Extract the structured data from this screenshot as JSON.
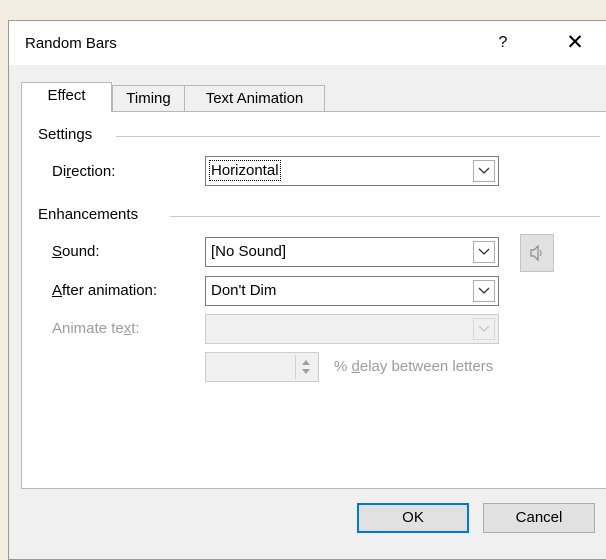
{
  "dialog": {
    "title": "Random Bars",
    "help_glyph": "?",
    "close_glyph": "✕"
  },
  "tabs": [
    {
      "label": "Effect",
      "active": true
    },
    {
      "label": "Timing",
      "active": false
    },
    {
      "label": "Text Animation",
      "active": false
    }
  ],
  "settings": {
    "group_label": "Settings",
    "direction": {
      "label_pre": "Di",
      "label_ul": "r",
      "label_post": "ection:",
      "value": "Horizontal"
    }
  },
  "enhancements": {
    "group_label": "Enhancements",
    "sound": {
      "label_ul": "S",
      "label_post": "ound:",
      "value": "[No Sound]",
      "speaker_icon": "speaker-icon"
    },
    "after_animation": {
      "label_ul": "A",
      "label_post": "fter animation:",
      "value": "Don't Dim"
    },
    "animate_text": {
      "label_pre": "Animate te",
      "label_ul": "x",
      "label_post": "t:",
      "value": ""
    },
    "delay": {
      "value": "",
      "label_pre": "% ",
      "label_ul": "d",
      "label_post": "elay between letters"
    }
  },
  "buttons": {
    "ok": "OK",
    "cancel": "Cancel"
  },
  "colors": {
    "accent": "#0078d7",
    "disabled_text": "#9c9c9c"
  }
}
